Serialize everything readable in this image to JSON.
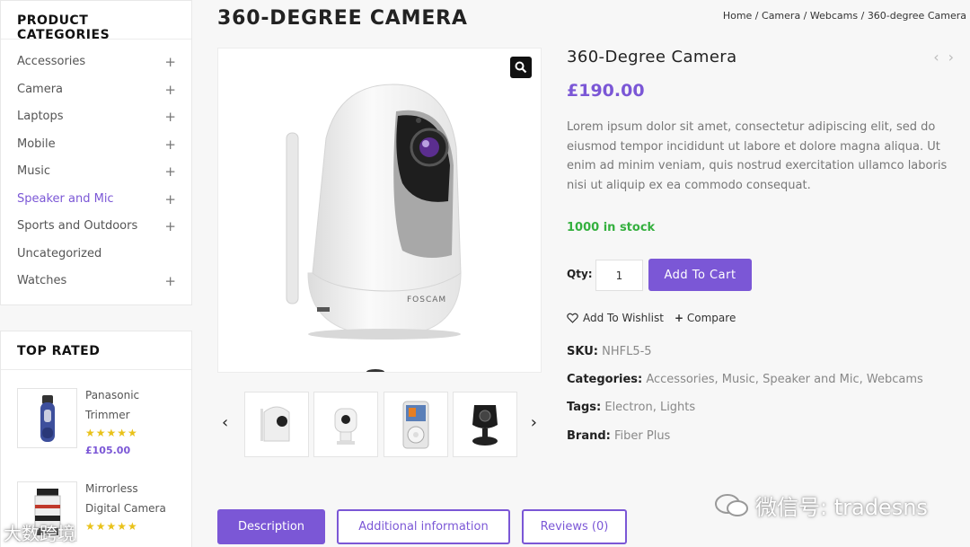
{
  "sidebar": {
    "categories_title": "PRODUCT CATEGORIES",
    "categories": [
      {
        "label": "Accessories",
        "expand": "+"
      },
      {
        "label": "Camera",
        "expand": "+"
      },
      {
        "label": "Laptops",
        "expand": "+"
      },
      {
        "label": "Mobile",
        "expand": "+"
      },
      {
        "label": "Music",
        "expand": "+"
      },
      {
        "label": "Speaker and Mic",
        "expand": "+"
      },
      {
        "label": "Sports and Outdoors",
        "expand": "+"
      },
      {
        "label": "Uncategorized",
        "expand": ""
      },
      {
        "label": "Watches",
        "expand": "+"
      }
    ],
    "top_rated_title": "TOP RATED",
    "top_rated": [
      {
        "name_line1": "Panasonic",
        "name_line2": "Trimmer",
        "stars": "★★★★★",
        "price": "£105.00"
      },
      {
        "name_line1": "Mirrorless",
        "name_line2": "Digital Camera",
        "stars": "★★★★★",
        "price": ""
      }
    ]
  },
  "header": {
    "title": "360-DEGREE CAMERA",
    "breadcrumb": [
      "Home",
      "Camera",
      "Webcams",
      "360-degree Camera"
    ],
    "breadcrumb_sep": " / "
  },
  "product": {
    "name": "360-Degree Camera",
    "price": "£190.00",
    "description": "Lorem ipsum dolor sit amet, consectetur adipiscing elit, sed do eiusmod tempor incididunt ut labore et dolore magna aliqua. Ut enim ad minim veniam, quis nostrud exercitation ullamco laboris nisi ut aliquip ex ea commodo consequat.",
    "stock": "1000 in stock",
    "qty_label": "Qty:",
    "qty_value": "1",
    "add_to_cart": "Add To Cart",
    "wishlist": "Add To Wishlist",
    "compare": "Compare",
    "brand_mark": "FOSCAM",
    "nav_prev": "‹",
    "nav_next": "›",
    "sku_label": "SKU:",
    "sku": "NHFL5-5",
    "categories_label": "Categories:",
    "categories": [
      "Accessories",
      "Music",
      "Speaker and Mic",
      "Webcams"
    ],
    "tags_label": "Tags:",
    "tags": [
      "Electron",
      "Lights"
    ],
    "brand_label": "Brand:",
    "brand": "Fiber Plus"
  },
  "gallery": {
    "prev": "‹",
    "next": "›",
    "thumbnails": [
      "camera-white-thumb",
      "baby-monitor-thumb",
      "ipod-thumb",
      "black-camera-thumb"
    ]
  },
  "tabs": [
    {
      "label": "Description",
      "active": true
    },
    {
      "label": "Additional information",
      "active": false
    },
    {
      "label": "Reviews (0)",
      "active": false
    }
  ],
  "watermark": {
    "right": "微信号: tradesns",
    "left": "大数跨境"
  },
  "colors": {
    "accent": "#7b57d6",
    "stock": "#35b03f",
    "stars": "#e9c21a"
  }
}
